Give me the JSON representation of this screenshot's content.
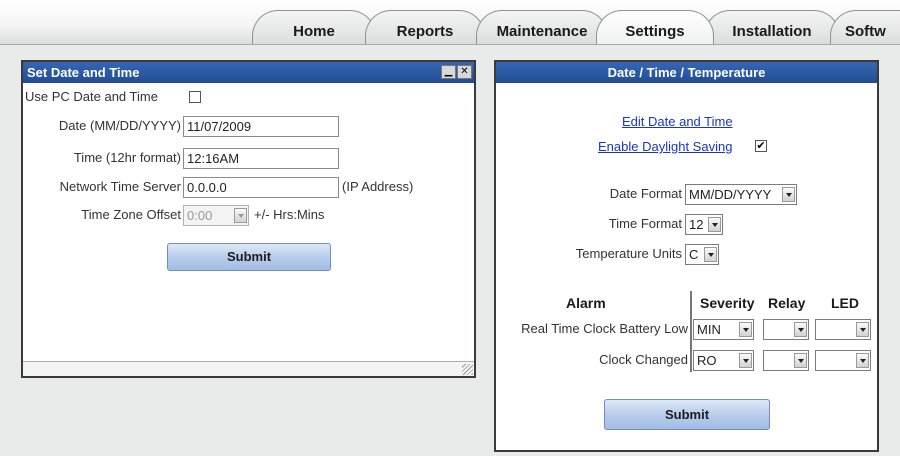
{
  "nav": {
    "tabs": [
      {
        "label": "Home"
      },
      {
        "label": "Reports"
      },
      {
        "label": "Maintenance"
      },
      {
        "label": "Settings"
      },
      {
        "label": "Installation"
      },
      {
        "label": "Softw"
      }
    ],
    "active_tab": "Settings"
  },
  "left_panel": {
    "title": "Set Date and Time",
    "minimize_glyph": "▁",
    "close_glyph": "✕",
    "use_pc_label": "Use PC Date and Time",
    "use_pc_checked": false,
    "date_label": "Date (MM/DD/YYYY)",
    "date_value": "11/07/2009",
    "time_label": "Time (12hr format)",
    "time_value": "12:16AM",
    "nts_label": "Network Time Server",
    "nts_value": "0.0.0.0",
    "nts_hint": "(IP Address)",
    "tz_label": "Time Zone Offset",
    "tz_value": "0:00",
    "tz_hint": "+/- Hrs:Mins",
    "submit_label": "Submit"
  },
  "right_panel": {
    "title": "Date / Time / Temperature",
    "edit_link": "Edit Date and Time",
    "dst_link": "Enable Daylight Saving",
    "dst_checked": true,
    "check_glyph": "✔",
    "date_format_label": "Date Format",
    "date_format_value": "MM/DD/YYYY",
    "time_format_label": "Time Format",
    "time_format_value": "12",
    "temp_units_label": "Temperature Units",
    "temp_units_value": "C",
    "alarm_header": "Alarm",
    "severity_header": "Severity",
    "relay_header": "Relay",
    "led_header": "LED",
    "alarms": [
      {
        "name": "Real Time Clock Battery Low",
        "severity": "MIN",
        "relay": "",
        "led": ""
      },
      {
        "name": "Clock Changed",
        "severity": "RO",
        "relay": "",
        "led": ""
      }
    ],
    "submit_label": "Submit"
  },
  "colors": {
    "title_bar": "#2b579e",
    "button": "#b5cbea",
    "link": "#1a35c8",
    "page_background": "#e9ebea"
  }
}
